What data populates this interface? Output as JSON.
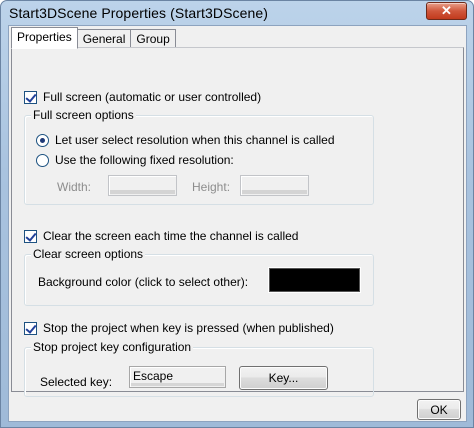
{
  "window": {
    "title": "Start3DScene Properties (Start3DScene)",
    "close_glyph": "✕"
  },
  "tabs": [
    {
      "label": "Properties",
      "active": true
    },
    {
      "label": "General",
      "active": false
    },
    {
      "label": "Group",
      "active": false
    }
  ],
  "fullscreen": {
    "checkbox_label": "Full screen (automatic or user controlled)",
    "checked": true,
    "group_title": "Full screen options",
    "option_user_select": "Let user select resolution when this channel is called",
    "option_fixed": "Use the following fixed resolution:",
    "selected_option": "user_select",
    "width_label": "Width:",
    "height_label": "Height:"
  },
  "clear_screen": {
    "checkbox_label": "Clear the screen each time the channel is called",
    "checked": true,
    "group_title": "Clear screen options",
    "bg_color_label": "Background color (click to select other):",
    "bg_color": "#000000"
  },
  "stop_key": {
    "checkbox_label": "Stop the project when key is pressed (when published)",
    "checked": true,
    "group_title": "Stop project key configuration",
    "selected_key_label": "Selected key:",
    "selected_key_value": "Escape",
    "key_button_label": "Key..."
  },
  "footer": {
    "ok_label": "OK"
  }
}
